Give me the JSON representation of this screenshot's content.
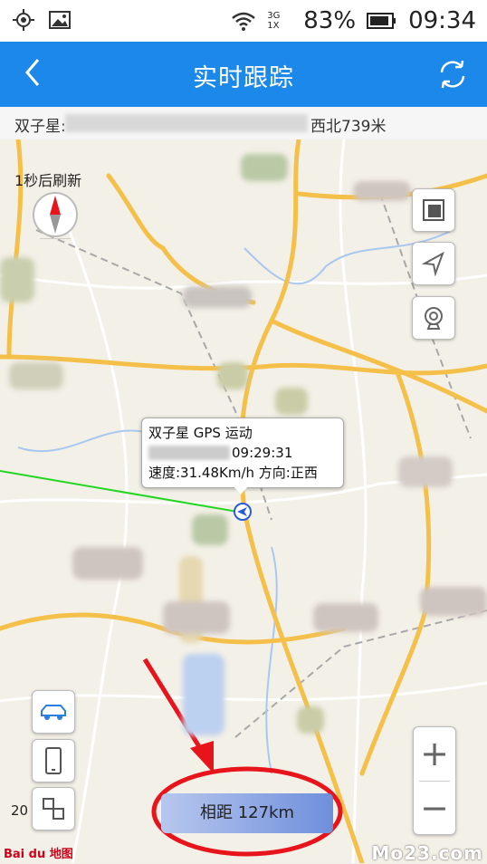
{
  "status_bar": {
    "battery": "83%",
    "time": "09:34",
    "network_top": "3G",
    "network_bottom": "1X"
  },
  "app_bar": {
    "title": "实时跟踪"
  },
  "info_bar": {
    "device_name": "双子星:",
    "direction_distance": "西北739米"
  },
  "map": {
    "refresh_hint": "1秒后刷新",
    "popup": {
      "line1": "双子星 GPS 运动",
      "time": "09:29:31",
      "line3": "速度:31.48Km/h  方向:正西"
    },
    "distance_label": "相距 127km",
    "scale_label": "20",
    "map_provider": "Bai du 地图",
    "watermark": "Mo23.com",
    "zoom_in": "+",
    "zoom_out": "−"
  },
  "colors": {
    "app_bar": "#1c88ea",
    "road_major": "#f5c04a",
    "track_line": "#22d622",
    "annotation": "#e8141c"
  },
  "icons": [
    "location-target-icon",
    "image-icon",
    "wifi-icon",
    "battery-icon",
    "back-arrow-icon",
    "refresh-icon",
    "compass-icon",
    "layers-icon",
    "navigate-icon",
    "camera-icon",
    "car-icon",
    "phone-icon",
    "switch-icon",
    "vehicle-marker-icon"
  ]
}
